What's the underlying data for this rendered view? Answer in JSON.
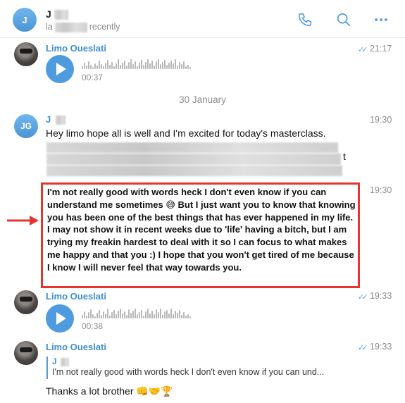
{
  "header": {
    "contact_initial": "J",
    "contact_name": "J",
    "status_prefix": "la",
    "status_suffix": "recently",
    "icons": [
      "phone-icon",
      "search-icon",
      "more-icon"
    ],
    "accent_color": "#4f9be0"
  },
  "messages": [
    {
      "sender": "Limo Oueslati",
      "type": "voice",
      "duration": "00:37",
      "time": "21:17",
      "read": true
    },
    {
      "type": "date_separator",
      "text": "30 January"
    },
    {
      "sender": "J",
      "avatar_initials": "JG",
      "type": "text",
      "text": "Hey limo hope all is well and I'm excited for today's masterclass.",
      "line_end_fragment": "t",
      "time": "19:30"
    },
    {
      "type": "text",
      "highlighted": true,
      "text": "I'm not really good with words heck I don't even know if you can understand me sometimes 😅 But I just want you to know that knowing you has been one of the best things that has ever happened in my life. I may not show it in recent weeks due to 'life' having a bitch, but I am trying my freakin hardest to deal with it so I can focus to what makes me happy and that you :) I hope that you won't get tired of me because I know I will never feel that way towards you.",
      "time": "19:30"
    },
    {
      "sender": "Limo Oueslati",
      "type": "voice",
      "duration": "00:38",
      "time": "19:33",
      "read": true
    },
    {
      "sender": "Limo Oueslati",
      "type": "reply",
      "reply_to_name": "J",
      "reply_to_text": "I'm not really good with words heck I don't even know if you can und...",
      "text": "Thanks a lot brother 👊🤝🏆",
      "time": "19:33",
      "read": true
    }
  ]
}
